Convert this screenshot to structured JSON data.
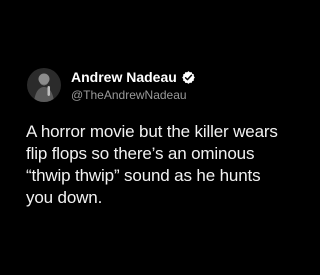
{
  "tweet": {
    "author": {
      "display_name": "Andrew Nadeau",
      "handle": "@TheAndrewNadeau",
      "verified": true,
      "avatar_icon": "avatar-photo"
    },
    "text": "A horror movie but the killer wears flip flops so there’s an ominous “thwip thwip” sound as he hunts you down."
  },
  "colors": {
    "background": "#000000",
    "text": "#f2f2f2",
    "handle": "#9a9a9a",
    "verified_badge_fill": "#ffffff"
  }
}
